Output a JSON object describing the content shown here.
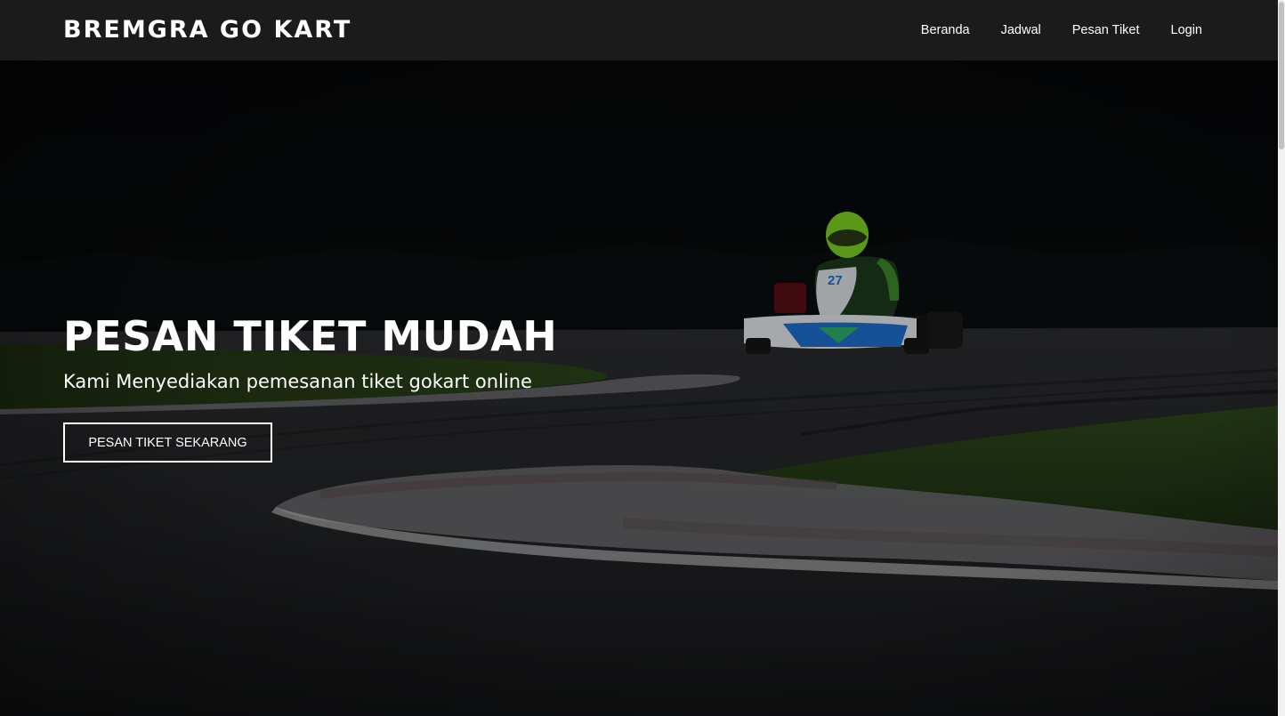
{
  "navbar": {
    "brand": "BREMGRA GO KART",
    "links": [
      {
        "label": "Beranda"
      },
      {
        "label": "Jadwal"
      },
      {
        "label": "Pesan Tiket"
      },
      {
        "label": "Login"
      }
    ]
  },
  "hero": {
    "title": "PESAN TIKET MUDAH",
    "subtitle": "Kami Menyediakan pemesanan tiket gokart online",
    "cta_label": "PESAN TIKET SEKARANG",
    "kart_number": "27"
  },
  "colors": {
    "navbar_bg": "#1b1b1b",
    "hero_overlay": "#000000",
    "text": "#ffffff",
    "helmet": "#7ed321",
    "kart_body": "#1f6fd1"
  }
}
